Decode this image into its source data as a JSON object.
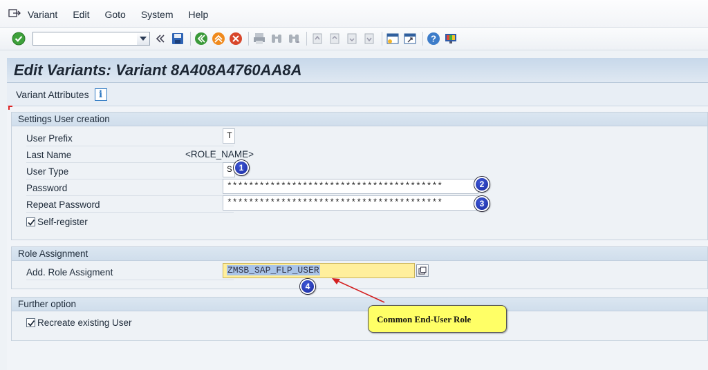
{
  "menu": {
    "items": [
      {
        "label": "Variant"
      },
      {
        "label": "Edit"
      },
      {
        "label": "Goto"
      },
      {
        "label": "System"
      },
      {
        "label": "Help"
      }
    ]
  },
  "toolbar": {
    "command_field_value": "",
    "icons": [
      "enter-icon",
      "back-double-icon",
      "save-icon",
      "back-icon",
      "exit-icon",
      "cancel-icon",
      "print-icon",
      "find-icon",
      "find-next-icon",
      "first-page-icon",
      "previous-page-icon",
      "next-page-icon",
      "last-page-icon",
      "create-session-icon",
      "shortcut-icon",
      "help-icon",
      "customize-layout-icon"
    ]
  },
  "page": {
    "title": "Edit Variants: Variant 8A408A4760AA8A",
    "subtoolbar_label": "Variant Attributes"
  },
  "settings": {
    "title": "Settings User creation",
    "user_prefix_label": "User Prefix",
    "user_prefix_value": "T",
    "last_name_label": "Last Name",
    "last_name_value": "<ROLE_NAME>",
    "user_type_label": "User Type",
    "user_type_value": "S",
    "password_label": "Password",
    "password_value": "****************************************",
    "repeat_password_label": "Repeat Password",
    "repeat_password_value": "****************************************",
    "self_register_label": "Self-register",
    "self_register_checked": true
  },
  "role": {
    "title": "Role Assignment",
    "add_role_label": "Add. Role Assigment",
    "add_role_value": "ZMSB_SAP_FLP_USER"
  },
  "further": {
    "title": "Further option",
    "recreate_label": "Recreate existing User",
    "recreate_checked": true
  },
  "annotations": {
    "badges": [
      "1",
      "2",
      "3",
      "4"
    ],
    "callout": "Common End-User Role",
    "colors": {
      "callout_bg": "#ffff66",
      "badge": "#1f32b8",
      "arrow": "#d42020",
      "highlight": "#ffef9c"
    }
  }
}
